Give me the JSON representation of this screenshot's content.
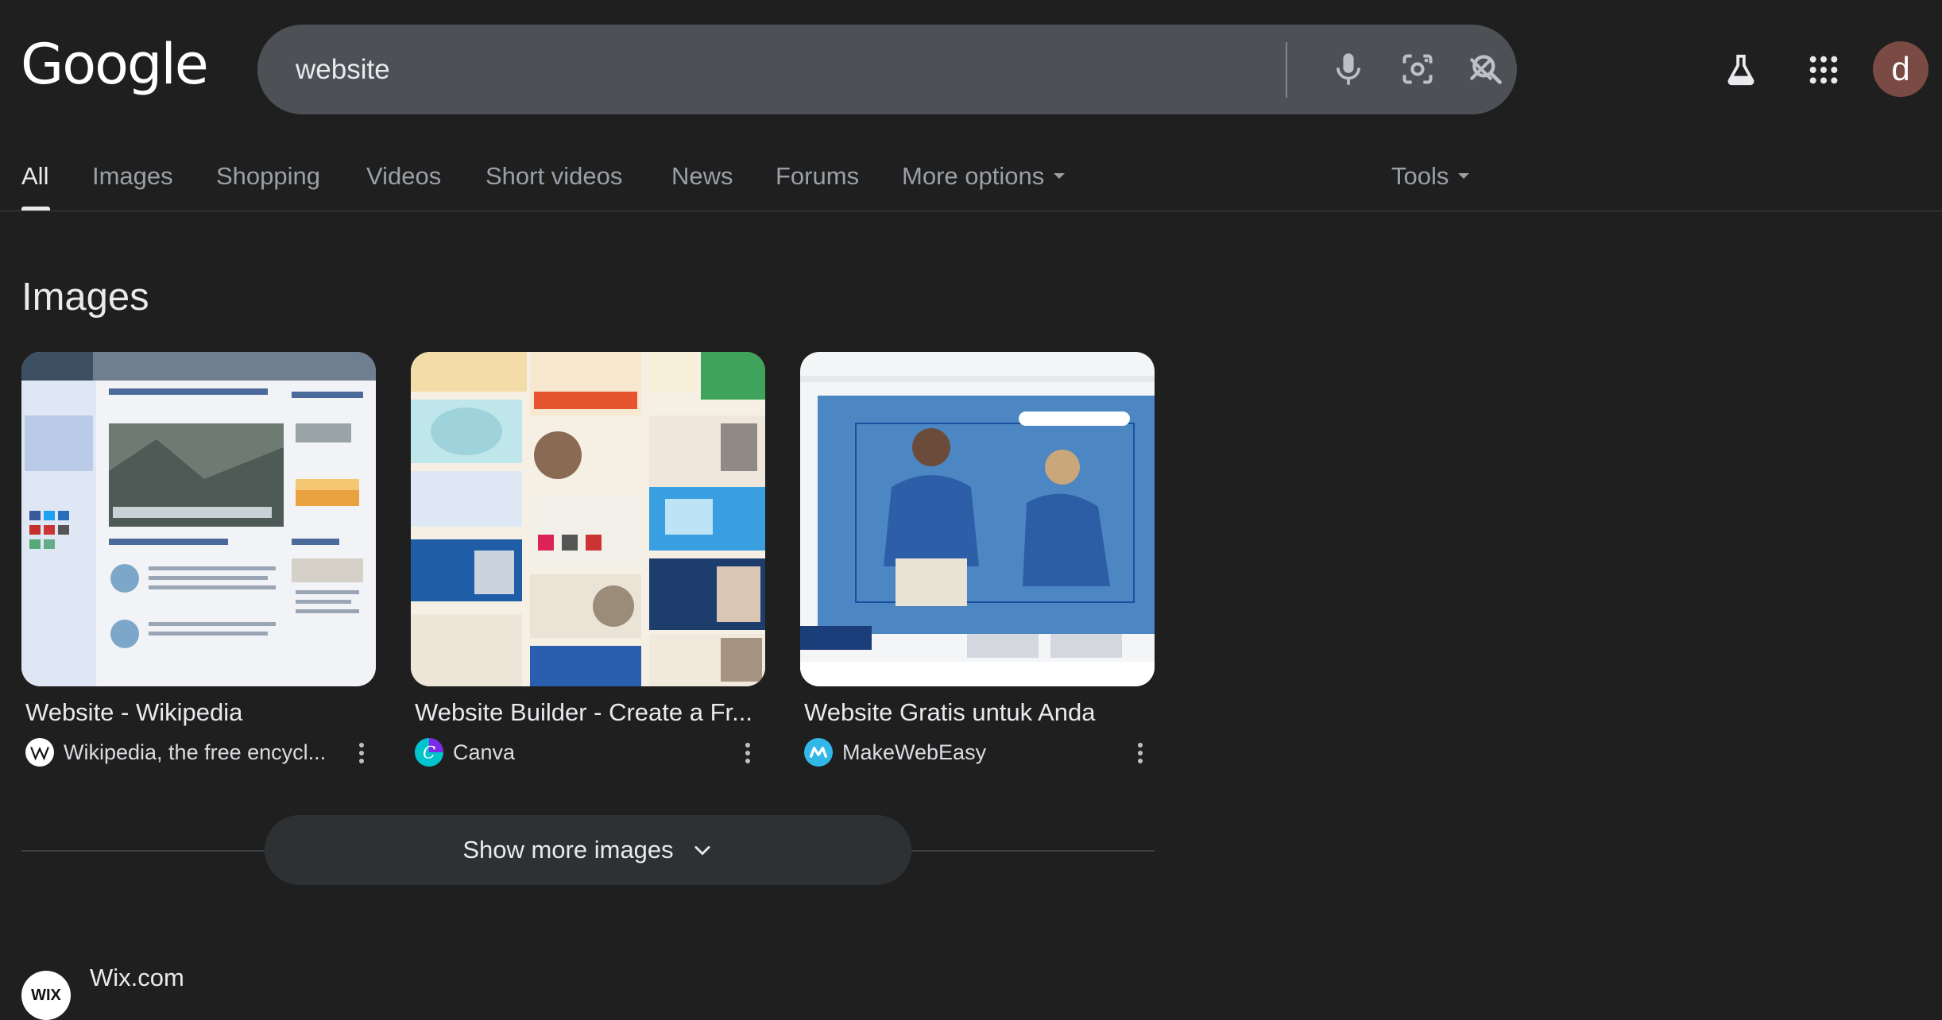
{
  "logo": {
    "text": "Google"
  },
  "search": {
    "query": "website"
  },
  "tabs": [
    {
      "label": "All"
    },
    {
      "label": "Images"
    },
    {
      "label": "Shopping"
    },
    {
      "label": "Videos"
    },
    {
      "label": "Short videos"
    },
    {
      "label": "News"
    },
    {
      "label": "Forums"
    },
    {
      "label": "More options"
    }
  ],
  "tools_label": "Tools",
  "avatar_letter": "d",
  "images_section": {
    "title": "Images",
    "results": [
      {
        "title": "Website - Wikipedia",
        "source": "Wikipedia, the free encycl..."
      },
      {
        "title": "Website Builder - Create a Fr...",
        "source": "Canva"
      },
      {
        "title": "Website Gratis untuk Anda",
        "source": "MakeWebEasy"
      }
    ],
    "show_more_label": "Show more images"
  },
  "next_result": {
    "favicon_text": "WIX",
    "site_name": "Wix.com"
  },
  "colors": {
    "background": "#1f1f1f",
    "search_bar": "#4d5156",
    "active_tab": "#e8eaed",
    "inactive_tab": "#9aa0a6"
  },
  "icons": [
    "clear-icon",
    "microphone-icon",
    "lens-icon",
    "search-icon",
    "labs-flask-icon",
    "apps-grid-icon",
    "chevron-down-icon",
    "more-vert-icon"
  ]
}
